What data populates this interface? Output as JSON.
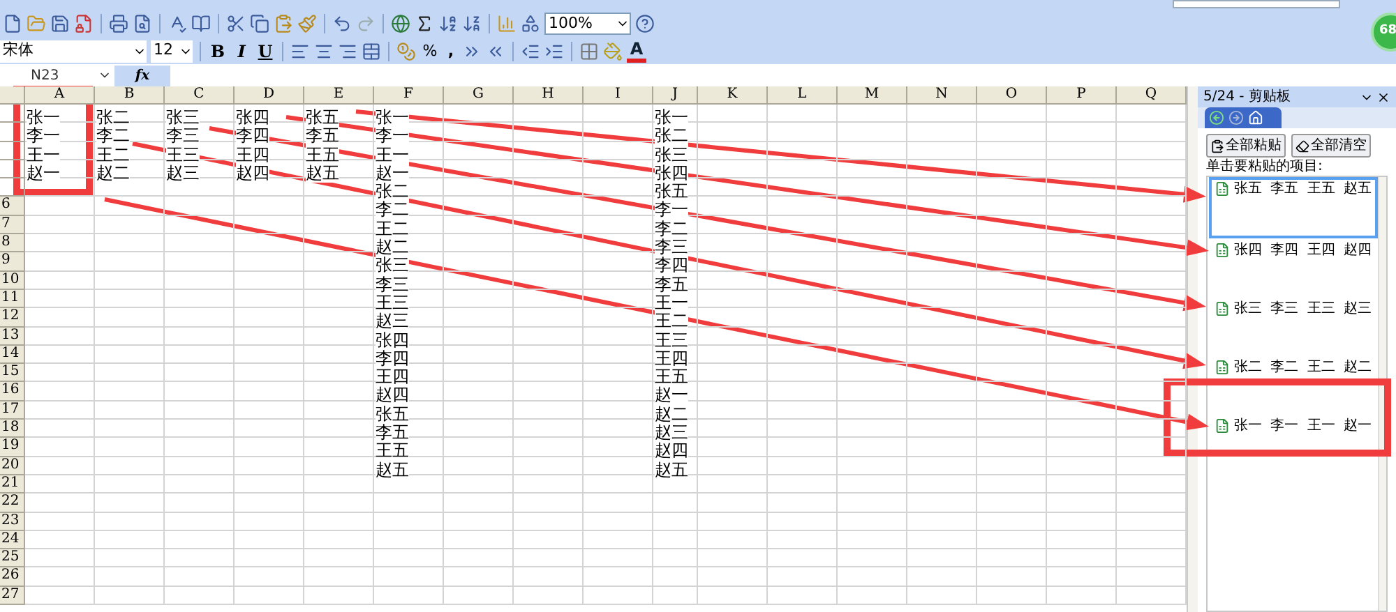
{
  "toolbar": {
    "zoom": "100%"
  },
  "format_toolbar": {
    "font": "宋体",
    "size": "12",
    "bold": "B",
    "italic": "I",
    "underline": "U",
    "percent": "%",
    "comma": ",",
    "font_color": "A"
  },
  "formula_bar": {
    "name_box": "N23",
    "function_label": "fx"
  },
  "badge": "68",
  "sheet": {
    "columns": [
      {
        "label": "A",
        "cells": [
          "张一",
          "李一",
          "王一",
          "赵一"
        ]
      },
      {
        "label": "B",
        "cells": [
          "张二",
          "李二",
          "王二",
          "赵二"
        ]
      },
      {
        "label": "C",
        "cells": [
          "张三",
          "李三",
          "王三",
          "赵三"
        ]
      },
      {
        "label": "D",
        "cells": [
          "张四",
          "李四",
          "王四",
          "赵四"
        ]
      },
      {
        "label": "E",
        "cells": [
          "张五",
          "李五",
          "王五",
          "赵五"
        ]
      },
      {
        "label": "F",
        "cells": [
          "张一",
          "李一",
          "王一",
          "赵一",
          "张二",
          "李二",
          "王二",
          "赵二",
          "张三",
          "李三",
          "王三",
          "赵三",
          "张四",
          "李四",
          "王四",
          "赵四",
          "张五",
          "李五",
          "王五",
          "赵五"
        ]
      },
      {
        "label": "G"
      },
      {
        "label": "H"
      },
      {
        "label": "I"
      },
      {
        "label": "J",
        "cells": [
          "张一",
          "张二",
          "张三",
          "张四",
          "张五",
          "李一",
          "李二",
          "李三",
          "李四",
          "李五",
          "王一",
          "王二",
          "王三",
          "王四",
          "王五",
          "赵一",
          "赵二",
          "赵三",
          "赵四",
          "赵五"
        ]
      },
      {
        "label": "K"
      },
      {
        "label": "L"
      },
      {
        "label": "M"
      },
      {
        "label": "N"
      },
      {
        "label": "O"
      },
      {
        "label": "P"
      },
      {
        "label": "Q"
      }
    ],
    "row_headers": [
      "6",
      "7",
      "8",
      "9",
      "10",
      "11",
      "12",
      "13",
      "14",
      "15",
      "16",
      "17",
      "18",
      "19",
      "20",
      "21",
      "22",
      "23",
      "24",
      "25",
      "26",
      "27"
    ]
  },
  "clipboard": {
    "title": "5/24 - 剪贴板",
    "paste_all": "全部粘贴",
    "clear_all": "全部清空",
    "hint": "单击要粘贴的项目:",
    "items": [
      {
        "text": "张五 李五 王五 赵五",
        "selected": true
      },
      {
        "text": "张四 李四 王四 赵四",
        "selected": false
      },
      {
        "text": "张三 李三 王三 赵三",
        "selected": false
      },
      {
        "text": "张二 李二 王二 赵二",
        "selected": false
      },
      {
        "text": "张一 李一 王一 赵一",
        "selected": false
      }
    ]
  }
}
